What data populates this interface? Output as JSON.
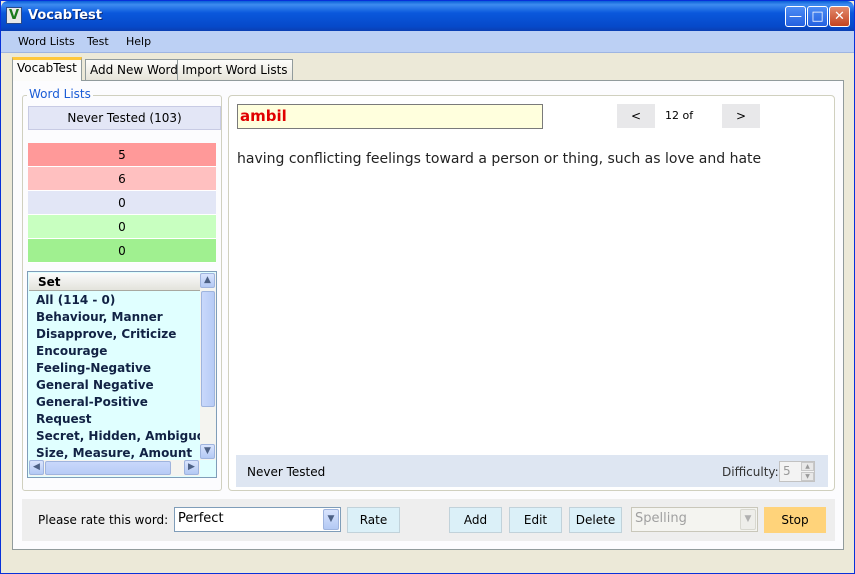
{
  "window": {
    "title": "VocabTest",
    "app_icon": "V"
  },
  "menu": [
    "Word Lists",
    "Test",
    "Help"
  ],
  "tabs": [
    "VocabTest",
    "Add New Word",
    "Import Word Lists"
  ],
  "word_lists": {
    "group_title": "Word Lists",
    "never_tested": "Never Tested (103)",
    "levels": [
      {
        "count": "5",
        "color": "#ff9999"
      },
      {
        "count": "6",
        "color": "#ffc0c0"
      },
      {
        "count": "0",
        "color": "#e2e6f6"
      },
      {
        "count": "0",
        "color": "#c8ffc0"
      },
      {
        "count": "0",
        "color": "#a0f090"
      }
    ],
    "set_header": "Set",
    "sets": [
      "All (114 - 0)",
      "Behaviour, Manner",
      "Disapprove, Criticize",
      "Encourage",
      "Feeling-Negative",
      "General Negative",
      "General-Positive",
      "Request",
      "Secret, Hidden, Ambiguous",
      "Size, Measure, Amount"
    ]
  },
  "card": {
    "word": "ambil",
    "prev": "<",
    "next": ">",
    "counter": "12 of",
    "definition": "having conflicting feelings toward a person or thing, such as love and hate",
    "status": "Never Tested",
    "difficulty_label": "Difficulty:",
    "difficulty_value": "5"
  },
  "bottom": {
    "rate_label": "Please rate this word:",
    "rating_value": "Perfect",
    "rate_button": "Rate",
    "add_button": "Add",
    "edit_button": "Edit",
    "delete_button": "Delete",
    "mode_value": "Spelling",
    "stop_button": "Stop"
  }
}
